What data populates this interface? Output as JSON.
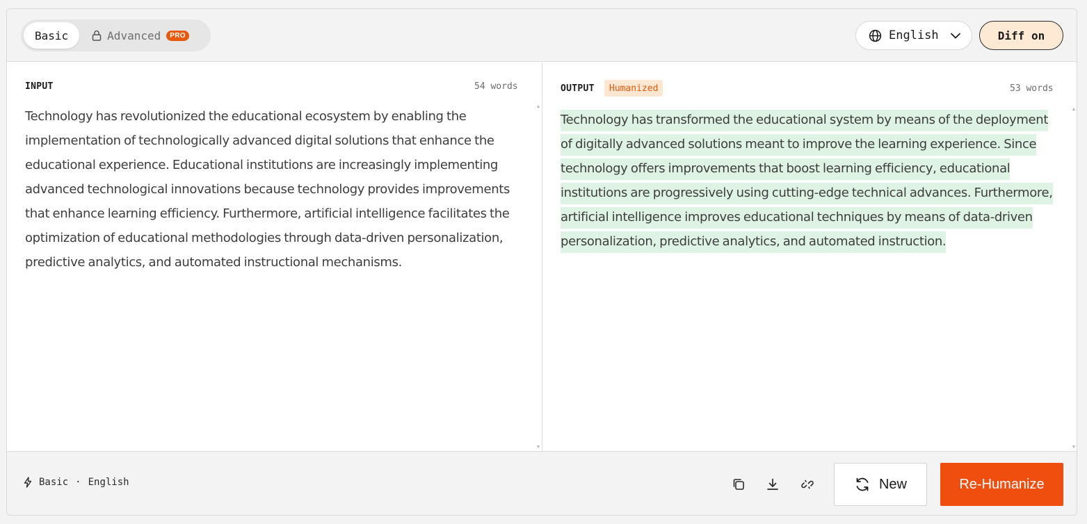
{
  "toolbar": {
    "mode_basic": "Basic",
    "mode_advanced": "Advanced",
    "pro_badge": "PRO",
    "language": "English",
    "diff_toggle": "Diff on"
  },
  "input": {
    "label": "INPUT",
    "word_count": "54 words",
    "text": "Technology has revolutionized the educational ecosystem by enabling the implementation of technologically advanced digital solutions that enhance the educational experience. Educational institutions are increasingly implementing advanced technological innovations because technology provides improvements that enhance learning efficiency. Furthermore, artificial intelligence facilitates the optimization of educational methodologies through data-driven personalization, predictive analytics, and automated instructional mechanisms."
  },
  "output": {
    "label": "OUTPUT",
    "badge": "Humanized",
    "word_count": "53 words",
    "text": "Technology has transformed the educational system by means of the deployment of digitally advanced solutions meant to improve the learning experience. Since technology offers improvements that boost learning efficiency, educational institutions are progressively using cutting-edge technical advances. Furthermore, artificial intelligence improves educational techniques by means of data-driven personalization, predictive analytics, and automated instruction."
  },
  "footer": {
    "mode": "Basic",
    "separator": "·",
    "language": "English",
    "new_label": "New",
    "rehumanize_label": "Re-Humanize"
  },
  "colors": {
    "accent": "#f04e0e",
    "diff_highlight": "#dff3e4",
    "diff_button_bg": "#fde9d4"
  },
  "icons": [
    "lock-icon",
    "globe-icon",
    "chevron-down-icon",
    "bolt-icon",
    "copy-icon",
    "download-icon",
    "unlink-icon",
    "refresh-icon"
  ]
}
